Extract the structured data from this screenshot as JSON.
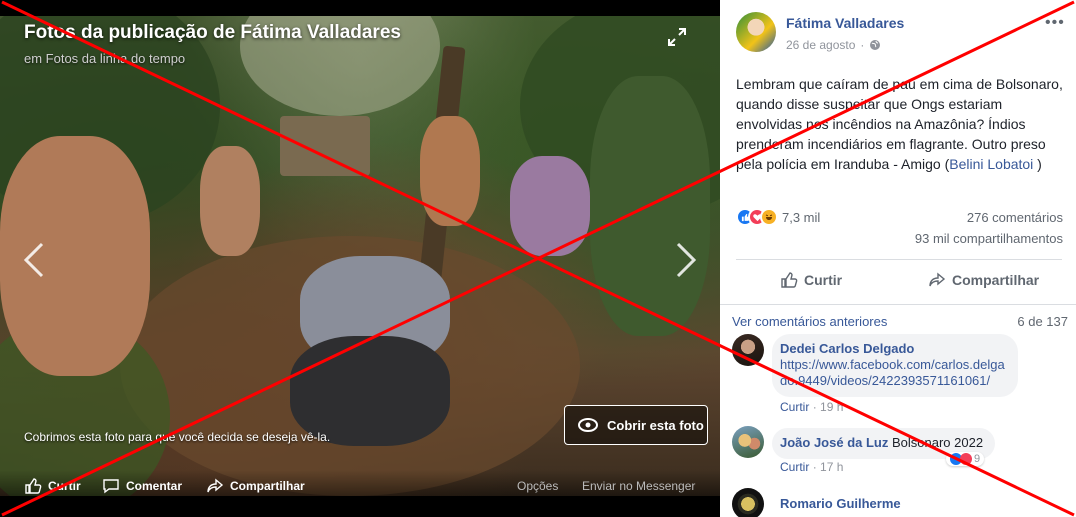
{
  "viewer": {
    "title": "Fotos da publicação de Fátima Valladares",
    "subtitle": "em Fotos da linha do tempo",
    "cover_notice": "Cobrimos esta foto para que você decida se deseja vê-la.",
    "cover_button_label": "Cobrir esta foto",
    "actions": {
      "like": "Curtir",
      "comment": "Comentar",
      "share": "Compartilhar",
      "options": "Opções",
      "messenger": "Enviar no Messenger"
    }
  },
  "post": {
    "author": "Fátima Valladares",
    "date": "26 de agosto",
    "text_main": "Lembram que caíram de pau em cima de Bolsonaro, quando disse suspeitar que Ongs estariam envolvidas nos incêndios na Amazônia? Índios prenderam incendiários em flagrante. Outro preso pela polícia em Iranduba - Amigo (",
    "text_link": "Belini Lobatoi",
    "text_end": " )",
    "reaction_count": "7,3 mil",
    "comments_count": "276 comentários",
    "shares_count": "93 mil compartilhamentos",
    "like_label": "Curtir",
    "share_label": "Compartilhar"
  },
  "comments_section": {
    "view_previous": "Ver comentários anteriores",
    "page_indicator": "6 de 137",
    "comments": [
      {
        "author": "Dedei Carlos Delgado",
        "text": "https://www.facebook.com/carlos.delgado.9449/videos/2422393571161061/",
        "reply": "Curtir",
        "time": "19 h"
      },
      {
        "author": "João José da Luz",
        "text": "Bolsonaro 2022",
        "reply": "Curtir",
        "time": "17 h",
        "reaction_count": "9"
      },
      {
        "author": "Romario Guilherme",
        "text": ""
      }
    ]
  },
  "colors": {
    "brand_link": "#385898",
    "overlay_x": "#ff0000",
    "like_blue": "#1877f2",
    "love_red": "#f33e58",
    "haha_yellow": "#f7b125"
  },
  "icons": [
    "expand-icon",
    "chevron-left-icon",
    "chevron-right-icon",
    "eye-slash-icon",
    "like-icon",
    "comment-icon",
    "share-icon",
    "globe-icon",
    "more-icon"
  ]
}
